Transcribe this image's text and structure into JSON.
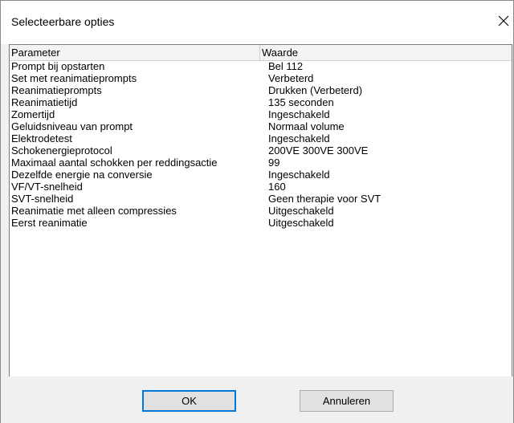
{
  "window": {
    "title": "Selecteerbare opties"
  },
  "table": {
    "columns": {
      "parameter": "Parameter",
      "value": "Waarde"
    },
    "rows": [
      {
        "parameter": "Prompt bij opstarten",
        "value": "Bel 112"
      },
      {
        "parameter": "Set met reanimatieprompts",
        "value": "Verbeterd"
      },
      {
        "parameter": "Reanimatieprompts",
        "value": "Drukken (Verbeterd)"
      },
      {
        "parameter": "Reanimatietijd",
        "value": "135 seconden"
      },
      {
        "parameter": "Zomertijd",
        "value": "Ingeschakeld"
      },
      {
        "parameter": "Geluidsniveau van prompt",
        "value": "Normaal volume"
      },
      {
        "parameter": "Elektrodetest",
        "value": "Ingeschakeld"
      },
      {
        "parameter": "Schokenergieprotocol",
        "value": "200VE  300VE  300VE"
      },
      {
        "parameter": "Maximaal aantal schokken per reddingsactie",
        "value": "99"
      },
      {
        "parameter": "Dezelfde energie na conversie",
        "value": "Ingeschakeld"
      },
      {
        "parameter": "VF/VT-snelheid",
        "value": "160"
      },
      {
        "parameter": "SVT-snelheid",
        "value": "Geen therapie voor SVT"
      },
      {
        "parameter": "Reanimatie met alleen compressies",
        "value": "Uitgeschakeld"
      },
      {
        "parameter": "Eerst reanimatie",
        "value": "Uitgeschakeld"
      }
    ]
  },
  "buttons": {
    "ok": "OK",
    "cancel": "Annuleren"
  },
  "icons": {
    "close": "close-icon"
  }
}
